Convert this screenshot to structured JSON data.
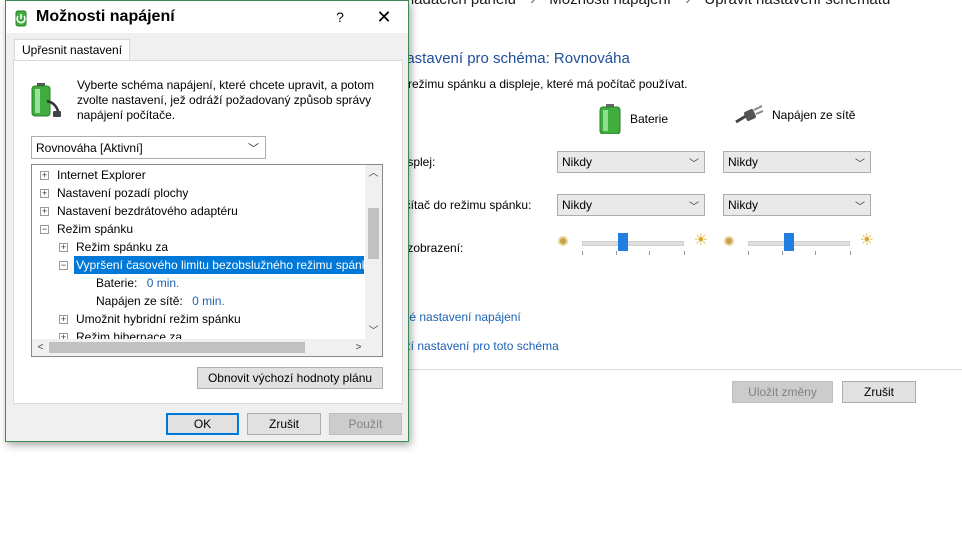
{
  "background": {
    "breadcrumb": [
      "y Ovládacích panelů",
      "Možnosti napájení",
      "Upravit nastavení schématu"
    ],
    "breadcrumb_sep": "›",
    "title": "nastavení pro schéma: Rovnováha",
    "description": "é režimu spánku a displeje, které má počítač používat.",
    "columns": {
      "battery": "Baterie",
      "plugged": "Napájen ze sítě"
    },
    "rows": {
      "display_label": "displej:",
      "sleep_label": "očítač do režimu spánku:",
      "brightness_label": "s zobrazení:"
    },
    "display_battery": "Nikdy",
    "display_plugged": "Nikdy",
    "sleep_battery": "Nikdy",
    "sleep_plugged": "Nikdy",
    "brightness_battery_level": 0.4,
    "brightness_plugged_level": 0.4,
    "link_advanced": "čilé nastavení napájení",
    "link_restore": "ozí nastavení pro toto schéma",
    "save_label": "Uložit změny",
    "cancel_label": "Zrušit"
  },
  "dialog": {
    "title": "Možnosti napájení",
    "help": "?",
    "close": "✕",
    "tab_label": "Upřesnit nastavení",
    "description": "Vyberte schéma napájení, které chcete upravit, a potom zvolte nastavení, jež odráží požadovaný způsob správy napájení počítače.",
    "scheme_value": "Rovnováha [Aktivní]",
    "tree": {
      "internet_explorer": "Internet Explorer",
      "desktop_background": "Nastavení pozadí plochy",
      "wireless_adapter": "Nastavení bezdrátového adaptéru",
      "sleep": "Režim spánku",
      "sleep_after": "Režim spánku za",
      "unattended_timeout": "Vypršení časového limitu bezobslužného režimu spánku",
      "battery_label": "Baterie:",
      "battery_value": "0 min.",
      "plugged_label": "Napájen ze sítě:",
      "plugged_value": "0 min.",
      "hybrid_sleep": "Umožnit hybridní režim spánku",
      "hibernate_after": "Režim hibernace za"
    },
    "restore_button": "Obnovit výchozí hodnoty plánu",
    "ok": "OK",
    "cancel": "Zrušit",
    "apply": "Použít"
  }
}
